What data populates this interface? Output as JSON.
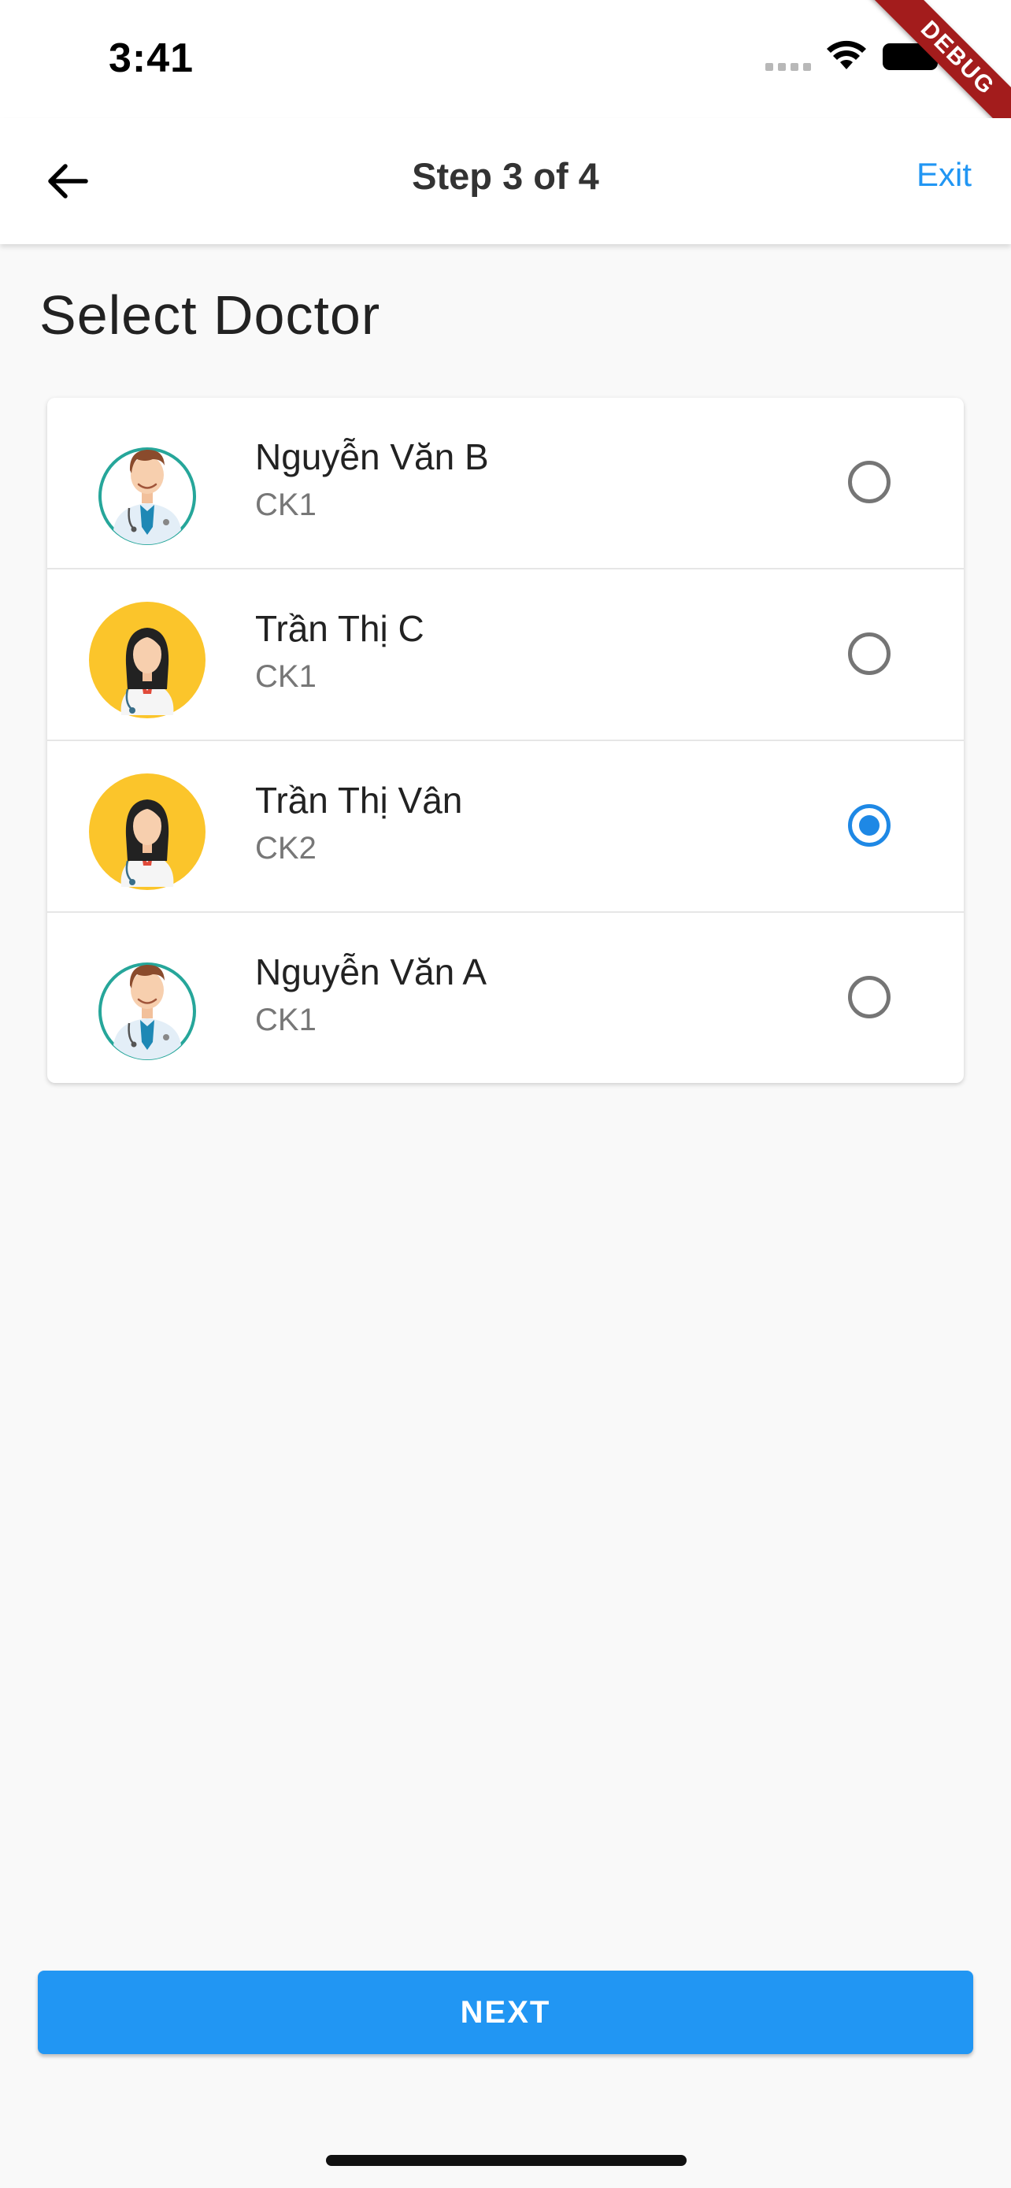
{
  "status_bar": {
    "time": "3:41"
  },
  "debug_banner": "DEBUG",
  "app_bar": {
    "title": "Step 3 of 4",
    "exit_label": "Exit"
  },
  "page": {
    "title": "Select Doctor"
  },
  "doctors": [
    {
      "name": "Nguyễn Văn B",
      "rank": "CK1",
      "avatar": "male-doctor",
      "selected": false
    },
    {
      "name": "Trần Thị C",
      "rank": "CK1",
      "avatar": "female-doctor",
      "selected": false
    },
    {
      "name": "Trần Thị Vân",
      "rank": "CK2",
      "avatar": "female-doctor",
      "selected": true
    },
    {
      "name": "Nguyễn Văn A",
      "rank": "CK1",
      "avatar": "male-doctor",
      "selected": false
    }
  ],
  "next_button": {
    "label": "NEXT"
  },
  "colors": {
    "accent": "#2196f3",
    "radio_selected": "#1e88e5",
    "debug": "#a31c1c"
  }
}
